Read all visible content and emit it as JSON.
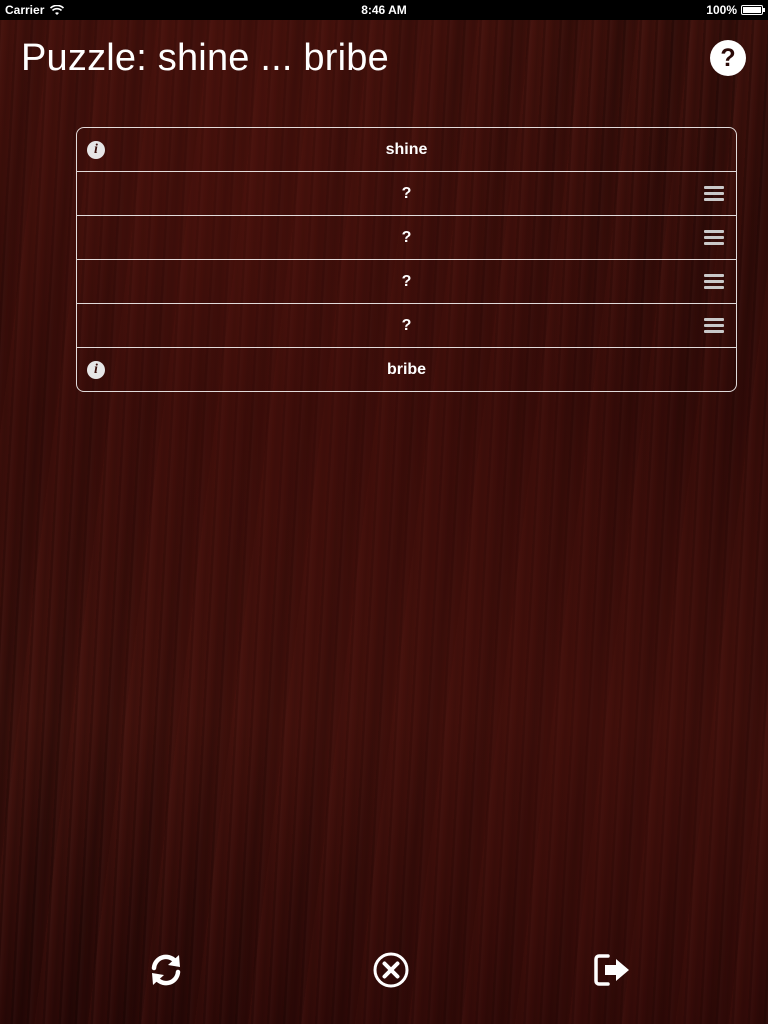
{
  "status_bar": {
    "carrier": "Carrier",
    "time": "8:46 AM",
    "battery": "100%"
  },
  "header": {
    "title": "Puzzle: shine ... bribe",
    "help_label": "?"
  },
  "puzzle": {
    "rows": [
      {
        "word": "shine",
        "fixed": true
      },
      {
        "word": "?",
        "fixed": false
      },
      {
        "word": "?",
        "fixed": false
      },
      {
        "word": "?",
        "fixed": false
      },
      {
        "word": "?",
        "fixed": false
      },
      {
        "word": "bribe",
        "fixed": true
      }
    ]
  },
  "toolbar": {
    "refresh_icon": "refresh-icon",
    "clear_icon": "clear-icon",
    "exit_icon": "exit-icon"
  },
  "colors": {
    "background": "#2e0a07",
    "text": "#ffffff"
  }
}
